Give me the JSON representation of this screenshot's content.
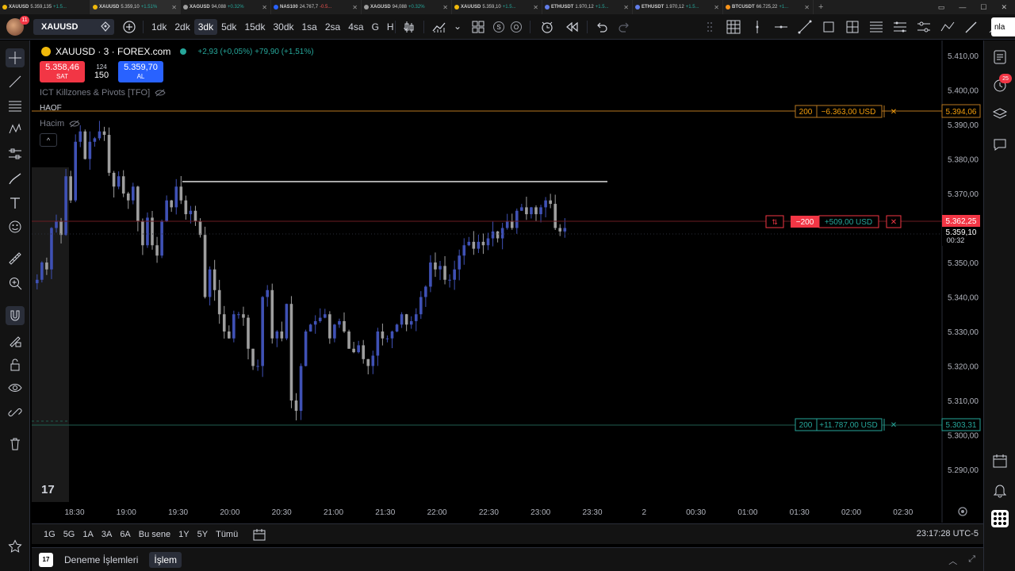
{
  "tabs": [
    {
      "symbol": "XAUUSD",
      "price": "5.359,135",
      "change": "+1.5..."
    },
    {
      "symbol": "XAUUSD",
      "price": "5.359,10",
      "change": "+1.51%"
    },
    {
      "symbol": "XAGUSD",
      "price": "94,088",
      "change": "+0.32%"
    },
    {
      "symbol": "NAS100",
      "price": "24.767,7",
      "change": "-0.5..."
    },
    {
      "symbol": "XAGUSD",
      "price": "94,088",
      "change": "+0.32%"
    },
    {
      "symbol": "XAUUSD",
      "price": "5.359,10",
      "change": "+1.5..."
    },
    {
      "symbol": "ETHUSDT",
      "price": "1.970,12",
      "change": "+1.5..."
    },
    {
      "symbol": "ETHUSDT",
      "price": "1.970,12",
      "change": "+1.5..."
    },
    {
      "symbol": "BTCUSDT",
      "price": "66.725,22",
      "change": "+1..."
    }
  ],
  "toolbar": {
    "avatar_badge": "11",
    "symbol": "XAUUSD",
    "intervals": [
      "1dk",
      "2dk",
      "3dk",
      "5dk",
      "15dk",
      "30dk",
      "1sa",
      "2sa",
      "4sa",
      "G",
      "H"
    ],
    "active_interval": "3dk",
    "circle_s": "S",
    "circle_o": "O",
    "scan_label": "nla"
  },
  "legend": {
    "title": "XAUUSD · 3 · FOREX.com",
    "change": "+2,93 (+0,05%)  +79,90 (+1,51%)",
    "sell_price": "5.358,46",
    "sell_label": "SAT",
    "spread": "124",
    "quantity": "150",
    "buy_price": "5.359,70",
    "buy_label": "AL",
    "indicator1": "ICT Killzones & Pivots [TFO]",
    "haof": "HAOF",
    "indicator2": "Hacim",
    "collapse": "^"
  },
  "orders": {
    "tp": {
      "qty": "200",
      "pnl": "−6.363,00 USD",
      "price": "5.394,06"
    },
    "pos": {
      "side": "⇅",
      "qty": "−200",
      "pnl": "+509,00 USD",
      "price": "5.362,25"
    },
    "sl": {
      "qty": "200",
      "pnl": "+11.787,00 USD",
      "price": "5.303,31"
    },
    "current_price": "5.359,10",
    "countdown": "00:32"
  },
  "chart_data": {
    "type": "candlestick",
    "y_ticks": [
      "5.410,00",
      "5.400,00",
      "5.390,00",
      "5.380,00",
      "5.370,00",
      "5.350,00",
      "5.340,00",
      "5.330,00",
      "5.320,00",
      "5.310,00",
      "5.300,00",
      "5.290,00"
    ],
    "x_ticks": [
      "18:30",
      "19:00",
      "19:30",
      "20:00",
      "20:30",
      "21:00",
      "21:30",
      "22:00",
      "22:30",
      "23:00",
      "23:30",
      "2",
      "00:30",
      "01:00",
      "01:30",
      "02:00",
      "02:30"
    ],
    "ylim": [
      5288,
      5412
    ],
    "close_path": [
      5345,
      5350,
      5348,
      5360,
      5362,
      5358,
      5375,
      5368,
      5385,
      5388,
      5380,
      5385,
      5386,
      5388,
      5387,
      5376,
      5372,
      5375,
      5370,
      5368,
      5372,
      5362,
      5355,
      5363,
      5355,
      5352,
      5362,
      5368,
      5366,
      5372,
      5368,
      5364,
      5365,
      5362,
      5358,
      5340,
      5348,
      5342,
      5335,
      5330,
      5328,
      5335,
      5335,
      5334,
      5325,
      5320,
      5320,
      5340,
      5342,
      5328,
      5330,
      5328,
      5338,
      5310,
      5307,
      5320,
      5330,
      5332,
      5333,
      5334,
      5335,
      5328,
      5332,
      5333,
      5330,
      5325,
      5324,
      5326,
      5322,
      5320,
      5323,
      5330,
      5328,
      5328,
      5330,
      5332,
      5335,
      5332,
      5333,
      5335,
      5340,
      5343,
      5350,
      5348,
      5349,
      5345,
      5345,
      5348,
      5352,
      5355,
      5356,
      5354,
      5356,
      5355,
      5357,
      5359,
      5357,
      5360,
      5362,
      5360,
      5365,
      5366,
      5364,
      5366,
      5364,
      5366,
      5368,
      5367,
      5360,
      5359,
      5360
    ]
  },
  "rangebar": {
    "ranges": [
      "1G",
      "5G",
      "1A",
      "3A",
      "6A",
      "Bu sene",
      "1Y",
      "5Y",
      "Tümü"
    ],
    "clock": "23:17:28 UTC-5"
  },
  "footer": {
    "logo": "17",
    "item1": "Deneme İşlemleri",
    "item2": "İşlem"
  },
  "rightbar": {
    "badge": "25"
  }
}
